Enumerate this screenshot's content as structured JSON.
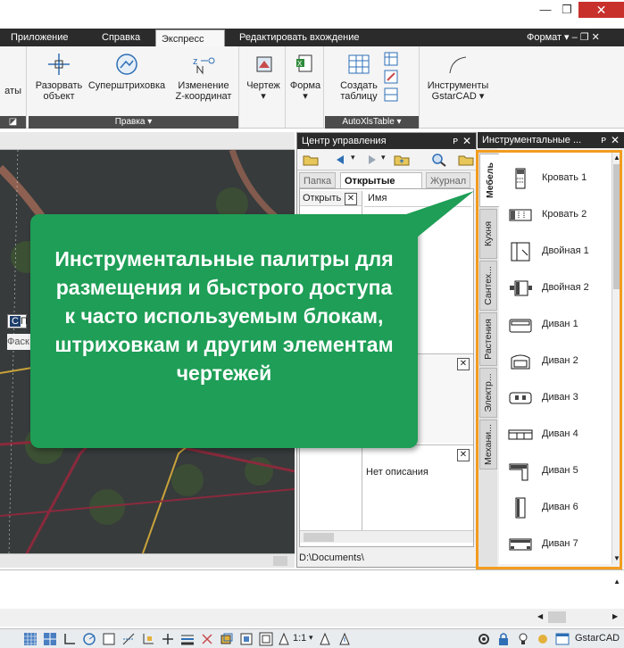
{
  "window": {
    "min_glyph": "—",
    "max_glyph": "❐",
    "close_glyph": "✕"
  },
  "ribbon_tabs": [
    "Приложение",
    "Справка",
    "Экспресс",
    "Редактировать вхождение"
  ],
  "ribbon_right": {
    "format": "Формат",
    "controls": "▾  ‒ ❐ ✕"
  },
  "ribbon": {
    "partial_label": "аты",
    "edit_group": {
      "buttons": [
        {
          "label": "Разорвать\nобъект",
          "icon": "break-object-icon"
        },
        {
          "label": "Суперштриховка",
          "icon": "superhatch-icon"
        },
        {
          "label": "Изменение\nZ-координат",
          "icon": "change-z-icon"
        }
      ],
      "footer": "Правка ▾"
    },
    "drawing_btn": {
      "label": "Чертеж",
      "arrow": "▾"
    },
    "form_btn": {
      "label": "Форма",
      "arrow": "▾"
    },
    "autoxls_group": {
      "create_table": "Создать\nтаблицу",
      "footer": "AutoXlsTable ▾"
    },
    "tools_btn": {
      "label": "Инструменты\nGstarCAD ▾"
    }
  },
  "design_center": {
    "title": "Центр управления",
    "pin": "ᴘ",
    "close": "✕",
    "tabs": [
      "Папка",
      "Открытые &ч...",
      "Журнал"
    ],
    "column_header": "Имя",
    "left_header": "Открыть",
    "no_description": "Нет описания",
    "path": "D:\\Documents\\"
  },
  "tool_palettes": {
    "title": "Инструментальные ...",
    "pin": "ᴘ",
    "close": "✕",
    "side_tabs": [
      "Мебель",
      "Кухня",
      "Сантех...",
      "Растения",
      "Электр...",
      "Механи..."
    ],
    "items": [
      {
        "label": "Кровать 1",
        "icon": "bed-icon"
      },
      {
        "label": "Кровать 2",
        "icon": "bed-icon"
      },
      {
        "label": "Двойная 1",
        "icon": "double-bed-icon"
      },
      {
        "label": "Двойная 2",
        "icon": "double-bed-icon"
      },
      {
        "label": "Диван 1",
        "icon": "sofa-icon"
      },
      {
        "label": "Диван 2",
        "icon": "sofa-icon"
      },
      {
        "label": "Диван 3",
        "icon": "sofa-icon"
      },
      {
        "label": "Диван 4",
        "icon": "sofa-icon"
      },
      {
        "label": "Диван 5",
        "icon": "sofa-icon"
      },
      {
        "label": "Диван 6",
        "icon": "sofa-icon"
      },
      {
        "label": "Диван 7",
        "icon": "sofa-icon"
      }
    ]
  },
  "drawing": {
    "partial_label_left": "П",
    "partial_label_fascia": "Фаск"
  },
  "callout": {
    "text": "Инструментальные палитры для размещения и быстрого доступа к часто используемым блокам, штриховкам и другим элементам чертежей",
    "color": "#1e9e56"
  },
  "statusbar": {
    "scale": "1:1",
    "app": "GstarCAD"
  },
  "colors": {
    "highlight": "#f39c1f",
    "tabbar": "#2b2b2b"
  }
}
